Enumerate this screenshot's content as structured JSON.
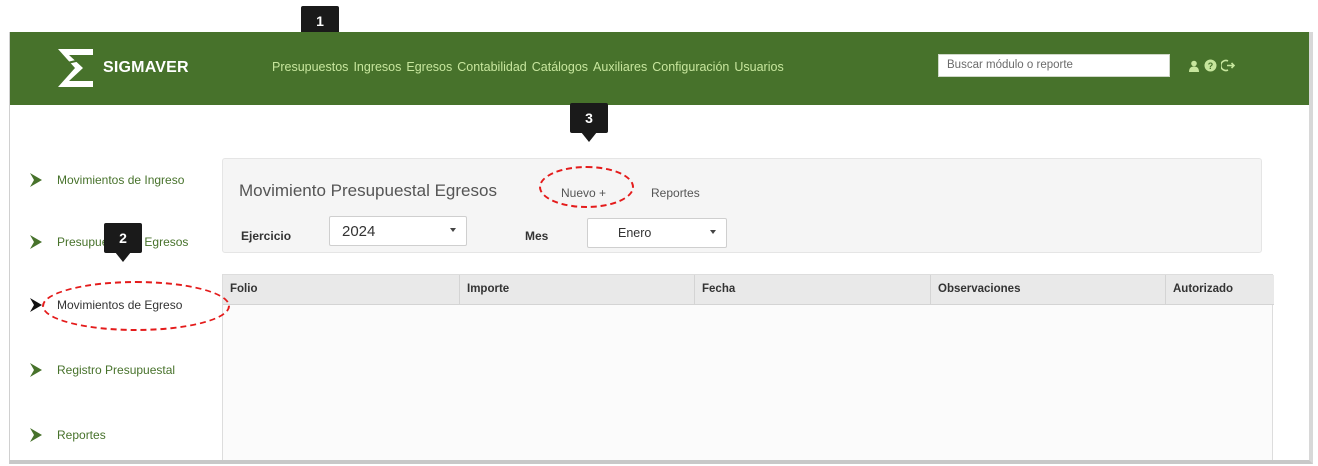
{
  "app": {
    "name": "SIGMAVER"
  },
  "nav": {
    "links": [
      "Presupuestos",
      "Ingresos",
      "Egresos",
      "Contabilidad",
      "Catálogos",
      "Auxiliares",
      "Configuración",
      "Usuarios"
    ],
    "search_placeholder": "Buscar módulo o reporte",
    "icons": [
      "user-icon",
      "help-icon",
      "logout-icon"
    ]
  },
  "sidebar": {
    "items": [
      {
        "label": "Movimientos de Ingreso"
      },
      {
        "label": "Presupuesto de Egresos"
      },
      {
        "label": "Movimientos de Egreso"
      },
      {
        "label": "Registro Presupuestal"
      },
      {
        "label": "Reportes"
      }
    ]
  },
  "panel": {
    "title": "Movimiento Presupuestal Egresos",
    "nuevo_label": "Nuevo +",
    "reportes_label": "Reportes",
    "ejercicio_label": "Ejercicio",
    "ejercicio_value": "2024",
    "mes_label": "Mes",
    "mes_value": "Enero"
  },
  "table": {
    "columns": [
      "Folio",
      "Importe",
      "Fecha",
      "Observaciones",
      "Autorizado"
    ]
  },
  "callouts": [
    "1",
    "2",
    "3"
  ],
  "colors": {
    "navbar": "#47722b",
    "nav_link": "#c7e69d",
    "sidebar_text": "#47722b",
    "annotation_red": "#e41b1b"
  }
}
